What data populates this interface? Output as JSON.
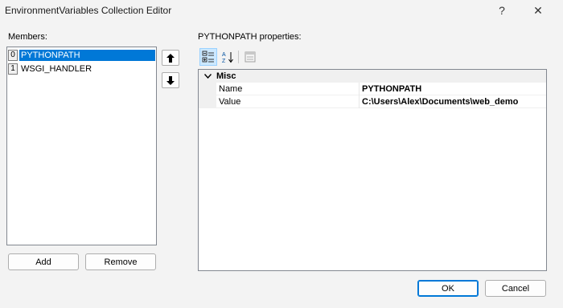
{
  "window": {
    "title": "EnvironmentVariables Collection Editor",
    "help_glyph": "?",
    "close_glyph": "✕"
  },
  "members": {
    "label": "Members:",
    "items": [
      {
        "index": "0",
        "label": "PYTHONPATH",
        "selected": true
      },
      {
        "index": "1",
        "label": "WSGI_HANDLER",
        "selected": false
      }
    ],
    "add_label": "Add",
    "remove_label": "Remove"
  },
  "properties": {
    "label": "PYTHONPATH properties:",
    "toolbar": {
      "categorized_icon": "categorized-icon",
      "alphabetical_icon": "sort-alphabetical-icon",
      "property_pages_icon": "property-pages-icon"
    },
    "category": "Misc",
    "rows": [
      {
        "name": "Name",
        "value": "PYTHONPATH"
      },
      {
        "name": "Value",
        "value": "C:\\Users\\Alex\\Documents\\web_demo"
      }
    ]
  },
  "footer": {
    "ok_label": "OK",
    "cancel_label": "Cancel"
  },
  "colors": {
    "selection": "#0078d7",
    "background": "#f3f3f3"
  }
}
